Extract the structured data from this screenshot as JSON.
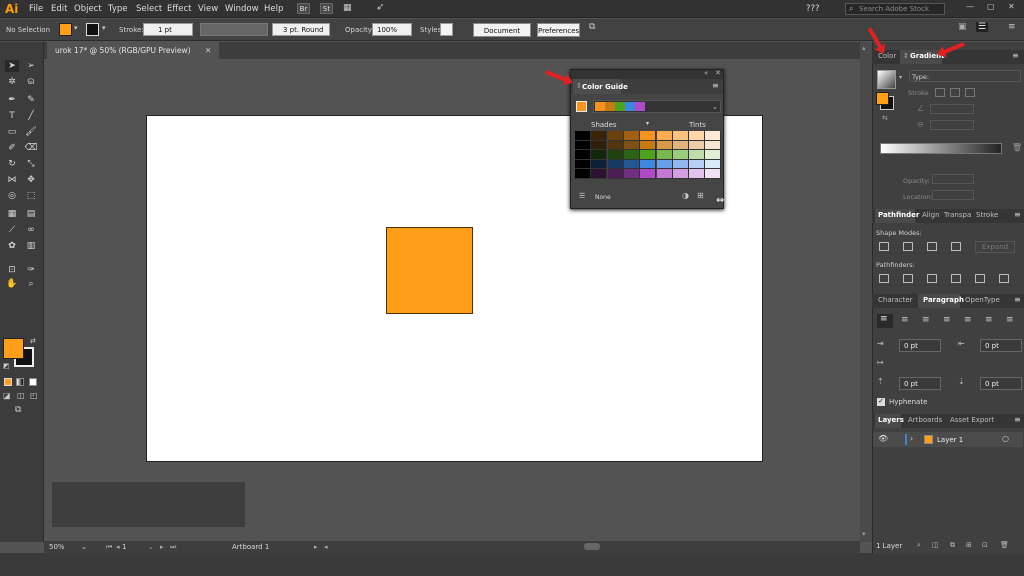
{
  "app": {
    "logo": "Ai",
    "menu": [
      "File",
      "Edit",
      "Object",
      "Type",
      "Select",
      "Effect",
      "View",
      "Window",
      "Help"
    ],
    "bridge_label": "Br",
    "stock_label": "St",
    "workspace": "???",
    "search_placeholder": "Search Adobe Stock"
  },
  "control": {
    "selection": "No Selection",
    "stroke_label": "Stroke:",
    "stroke_weight": "1 pt",
    "brush": "3 pt. Round",
    "opacity_label": "Opacity:",
    "opacity": "100%",
    "styles_label": "Styles",
    "doc_setup": "Document Setup",
    "preferences": "Preferences"
  },
  "document": {
    "tab": "urok 17* @ 50% (RGB/GPU Preview)"
  },
  "status": {
    "zoom": "50%",
    "artboard_num": "1",
    "artboard_name": "Artboard 1"
  },
  "colors": {
    "fill": "#ff9e18",
    "shape": "#ff9e18"
  },
  "color_guide": {
    "title": "Color Guide",
    "shades": "Shades",
    "tints": "Tints",
    "none": "None",
    "harmony": [
      "#f7931e",
      "#c77b13",
      "#4fa21e",
      "#3f86e0",
      "#b04bc8"
    ],
    "grid": [
      [
        "#000000",
        "#3a2409",
        "#6b410c",
        "#a35f10",
        "#f7931e",
        "#fbac4f",
        "#fcc27f",
        "#fdd6aa",
        "#fee9d4"
      ],
      [
        "#000000",
        "#2f1f0a",
        "#54360e",
        "#7c5113",
        "#c77b13",
        "#d69a4a",
        "#e1b47e",
        "#ebcda9",
        "#f5e6d2"
      ],
      [
        "#000000",
        "#12260a",
        "#1f4210",
        "#2d6315",
        "#4fa21e",
        "#77b84e",
        "#9dcb7d",
        "#c2ddab",
        "#e2eed6"
      ],
      [
        "#000000",
        "#0e2037",
        "#183a62",
        "#235792",
        "#3f86e0",
        "#68a0e8",
        "#90b9ef",
        "#b7d1f4",
        "#dbe8fa"
      ],
      [
        "#000000",
        "#2a1230",
        "#4b1f55",
        "#702f80",
        "#b04bc8",
        "#c278d5",
        "#d29fe0",
        "#e2c3eb",
        "#f1e1f5"
      ]
    ]
  },
  "right_panel": {
    "color_tab": "Color",
    "gradient_tab": "Gradient",
    "type_label": "Type:",
    "stroke_label": "Stroke",
    "opacity_label": "Opacity:",
    "location_label": "Location:",
    "pathfinder_tabs": [
      "Pathfinder",
      "Align",
      "Transpa",
      "Stroke"
    ],
    "shape_modes": "Shape Modes:",
    "expand": "Expand",
    "pathfinders": "Pathfinders:",
    "para_tabs": [
      "Character",
      "Paragraph",
      "OpenType"
    ],
    "indent": [
      "0 pt",
      "0 pt",
      "0 pt",
      "0 pt"
    ],
    "hyphenate": "Hyphenate",
    "layer_tabs": [
      "Layers",
      "Artboards",
      "Asset Export"
    ],
    "layer_name": "Layer 1",
    "layer_count": "1 Layer"
  }
}
